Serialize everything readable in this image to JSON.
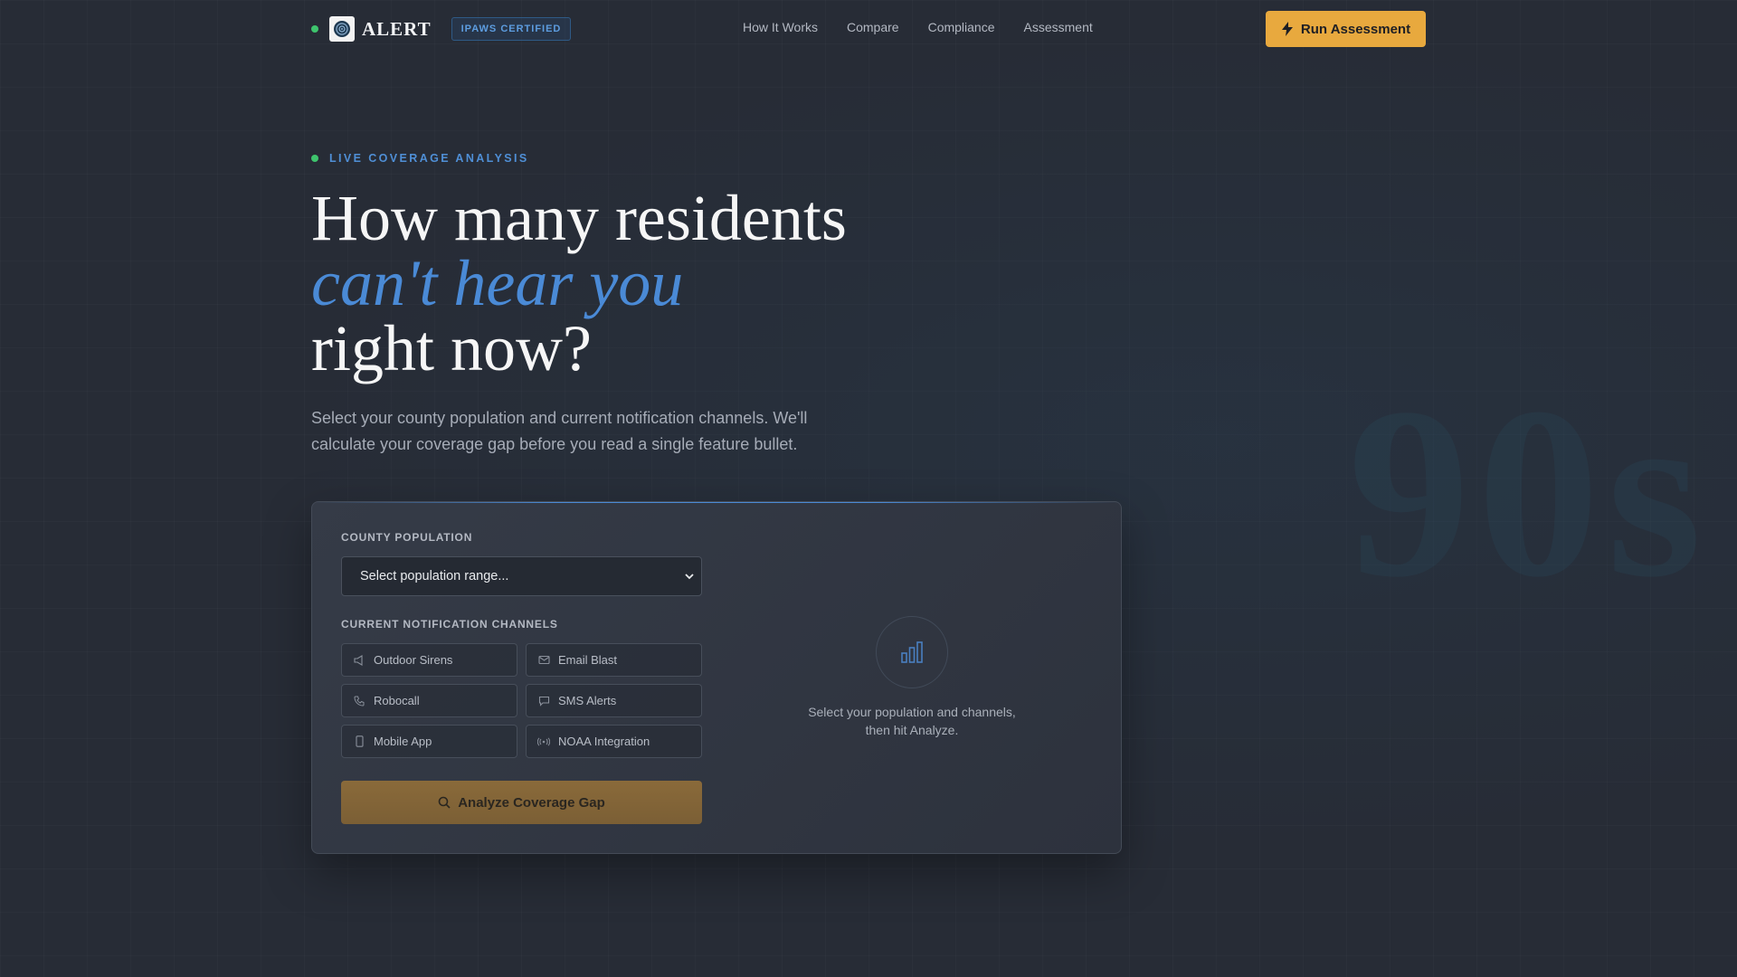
{
  "background_number": "90s",
  "header": {
    "brand_name": "ALERT",
    "badge": "IPAWS CERTIFIED",
    "nav": [
      "How It Works",
      "Compare",
      "Compliance",
      "Assessment"
    ],
    "cta_label": "Run Assessment"
  },
  "hero": {
    "eyebrow": "LIVE COVERAGE ANALYSIS",
    "headline_line1": "How many residents",
    "headline_accent": "can't hear you",
    "headline_line3": "right now?",
    "subtitle": "Select your county population and current notification channels. We'll calculate your coverage gap before you read a single feature bullet."
  },
  "card": {
    "population_label": "COUNTY POPULATION",
    "population_placeholder": "Select population range...",
    "channels_label": "CURRENT NOTIFICATION CHANNELS",
    "channels": [
      {
        "label": "Outdoor Sirens",
        "icon": "megaphone-icon"
      },
      {
        "label": "Email Blast",
        "icon": "mail-icon"
      },
      {
        "label": "Robocall",
        "icon": "phone-icon"
      },
      {
        "label": "SMS Alerts",
        "icon": "message-icon"
      },
      {
        "label": "Mobile App",
        "icon": "smartphone-icon"
      },
      {
        "label": "NOAA Integration",
        "icon": "radio-icon"
      }
    ],
    "analyze_label": "Analyze Coverage Gap",
    "empty_state": "Select your population and channels, then hit Analyze."
  },
  "colors": {
    "accent_blue": "#4a8ad6",
    "cta_orange": "#e8a93e",
    "live_green": "#3ec46d",
    "background": "#272c36"
  }
}
